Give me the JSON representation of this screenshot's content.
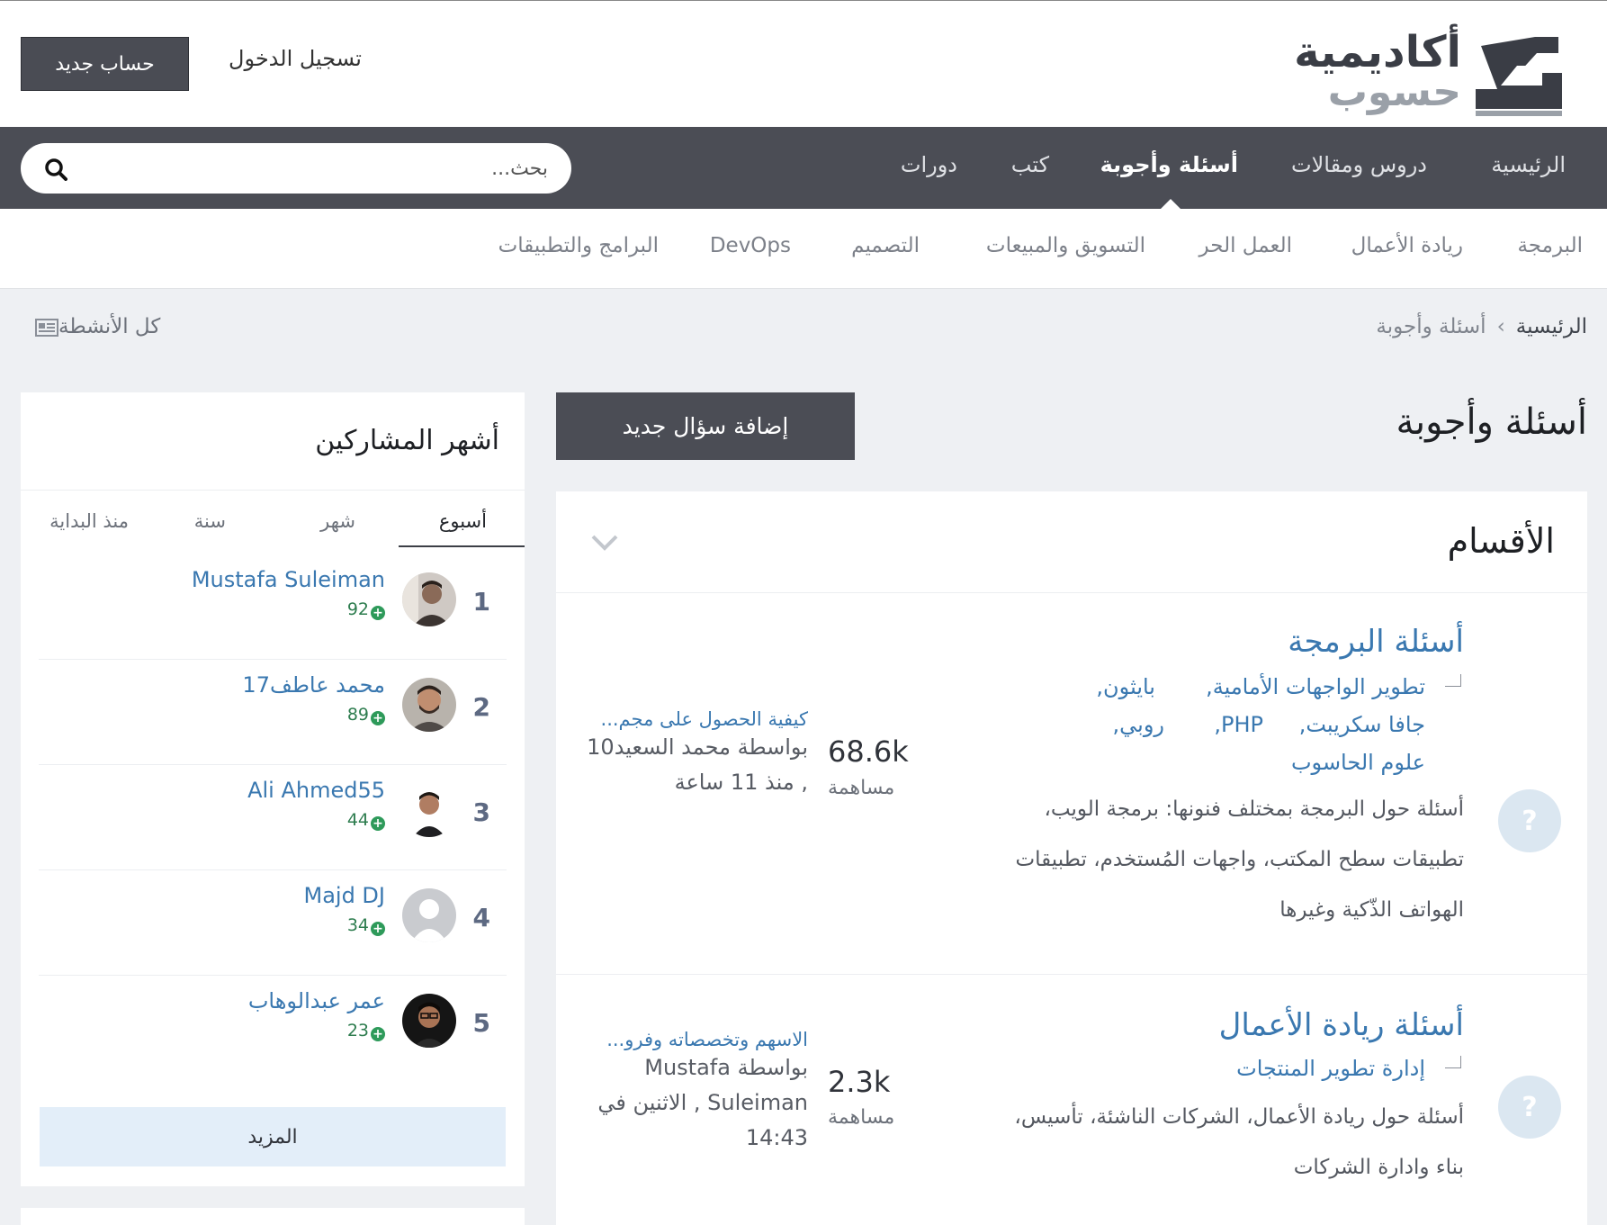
{
  "header": {
    "logo_line1": "أكاديمية",
    "logo_line2": "حسوب",
    "register_label": "حساب جديد",
    "login_label": "تسجيل الدخول"
  },
  "mainnav": {
    "items": [
      "الرئيسية",
      "دروس ومقالات",
      "أسئلة وأجوبة",
      "كتب",
      "دورات"
    ],
    "active": "أسئلة وأجوبة",
    "search_placeholder": "بحث..."
  },
  "subnav": {
    "items": [
      "البرمجة",
      "ريادة الأعمال",
      "العمل الحر",
      "التسويق والمبيعات",
      "التصميم",
      "DevOps",
      "البرامج والتطبيقات"
    ]
  },
  "breadcrumb": {
    "home": "الرئيسية",
    "separator": "›",
    "current": "أسئلة وأجوبة"
  },
  "all_activities_label": "كل الأنشطة",
  "page_title": "أسئلة وأجوبة",
  "add_question_label": "إضافة سؤال جديد",
  "categories": {
    "title": "الأقسام",
    "items": [
      {
        "icon": "?",
        "name": "أسئلة البرمجة",
        "tags": [
          "تطوير الواجهات الأمامية,",
          "بايثون,",
          "جافا سكريبت,",
          "PHP,",
          "روبي,",
          "علوم الحاسوب"
        ],
        "desc": "أسئلة حول البرمجة بمختلف فنونها: برمجة الويب، تطبيقات سطح المكتب، واجهات المُستخدم، تطبيقات الهواتف الذّكية وغيرها",
        "count": "68.6k",
        "count_label": "مساهمة",
        "last_title": "كيفية الحصول على مجم...",
        "last_by": "بواسطة محمد السعيد10 , منذ 11 ساعة"
      },
      {
        "icon": "?",
        "name": "أسئلة ريادة الأعمال",
        "tags": [
          "إدارة تطوير المنتجات"
        ],
        "desc": "أسئلة حول ريادة الأعمال، الشركات الناشئة، تأسيس، بناء وادارة الشركات",
        "count": "2.3k",
        "count_label": "مساهمة",
        "last_title": "الاسهم وتخصصاته وفرو...",
        "last_by": "بواسطة Mustafa Suleiman , الاثنين في 14:43"
      }
    ]
  },
  "leaders": {
    "title": "أشهر المشاركين",
    "tabs": [
      "أسبوع",
      "شهر",
      "سنة",
      "منذ البداية"
    ],
    "active_tab": "أسبوع",
    "items": [
      {
        "rank": "1",
        "name": "Mustafa Suleiman",
        "points": "92"
      },
      {
        "rank": "2",
        "name": "محمد عاطف17",
        "points": "89"
      },
      {
        "rank": "3",
        "name": "Ali Ahmed55",
        "points": "44"
      },
      {
        "rank": "4",
        "name": "Majd DJ",
        "points": "34"
      },
      {
        "rank": "5",
        "name": "عمر عبدالوهاب",
        "points": "23"
      }
    ],
    "more_label": "المزيد"
  },
  "colors": {
    "nav_bg": "#4b4d55",
    "link_blue": "#3a78b0",
    "points_green": "#2e7d4f",
    "question_icon_bg": "#dbe7f1"
  }
}
